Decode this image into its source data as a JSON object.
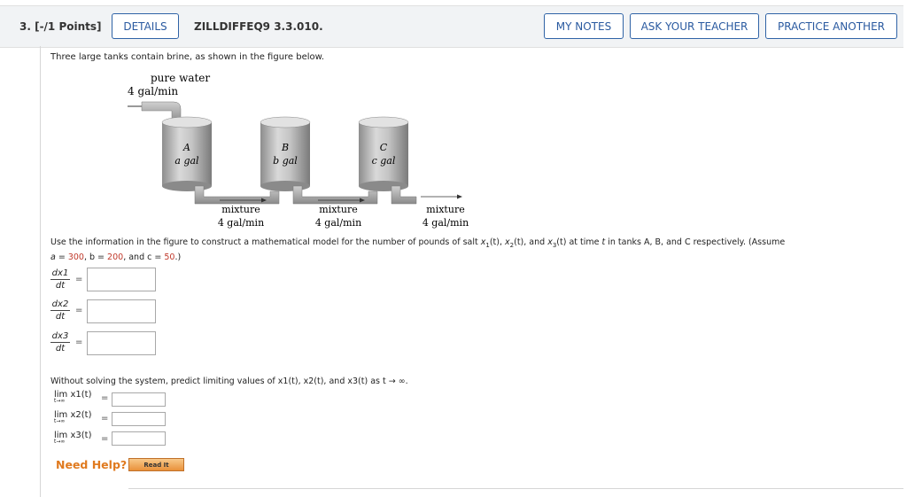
{
  "header": {
    "question_number": "3. [-/1 Points]",
    "details_label": "DETAILS",
    "problem_code": "ZILLDIFFEQ9 3.3.010.",
    "my_notes_label": "MY NOTES",
    "ask_teacher_label": "ASK YOUR TEACHER",
    "practice_label": "PRACTICE ANOTHER"
  },
  "intro": "Three large tanks contain brine, as shown in the figure below.",
  "figure": {
    "inlet_label": "pure water",
    "inlet_rate": "4 gal/min",
    "tanks": [
      {
        "name": "A",
        "volume": "a gal"
      },
      {
        "name": "B",
        "volume": "b gal"
      },
      {
        "name": "C",
        "volume": "c gal"
      }
    ],
    "flows": [
      {
        "label": "mixture",
        "rate": "4 gal/min"
      },
      {
        "label": "mixture",
        "rate": "4 gal/min"
      },
      {
        "label": "mixture",
        "rate": "4 gal/min"
      }
    ]
  },
  "instructions": {
    "text1": "Use the information in the figure to construct a mathematical model for the number of pounds of salt ",
    "x1": "x",
    "s1": "1",
    "t1": "(t), ",
    "x2": "x",
    "s2": "2",
    "t2": "(t), and ",
    "x3": "x",
    "s3": "3",
    "t3": "(t) at time ",
    "tvar": "t",
    "text2": " in tanks A, B, and C respectively. (Assume",
    "a_eq": "a = ",
    "a_val": "300",
    "b_eq": ", b = ",
    "b_val": "200",
    "c_eq": ", and c = ",
    "c_val": "50",
    "end": ".)"
  },
  "derivatives": [
    {
      "top": "dx1",
      "bottom": "dt",
      "equals": "="
    },
    {
      "top": "dx2",
      "bottom": "dt",
      "equals": "="
    },
    {
      "top": "dx3",
      "bottom": "dt",
      "equals": "="
    }
  ],
  "limits_prompt": "Without solving the system, predict limiting values of x1(t), x2(t), and x3(t) as t → ∞.",
  "limits": [
    {
      "expr": "lim x1(t)",
      "sub": "t→∞",
      "equals": "="
    },
    {
      "expr": "lim x2(t)",
      "sub": "t→∞",
      "equals": "="
    },
    {
      "expr": "lim x3(t)",
      "sub": "t→∞",
      "equals": "="
    }
  ],
  "help": {
    "label": "Need Help?",
    "read_it": "Read It"
  },
  "colors": {
    "accent_blue": "#2a5aa0",
    "help_orange": "#e07a1f",
    "value_red": "#c0392b"
  }
}
